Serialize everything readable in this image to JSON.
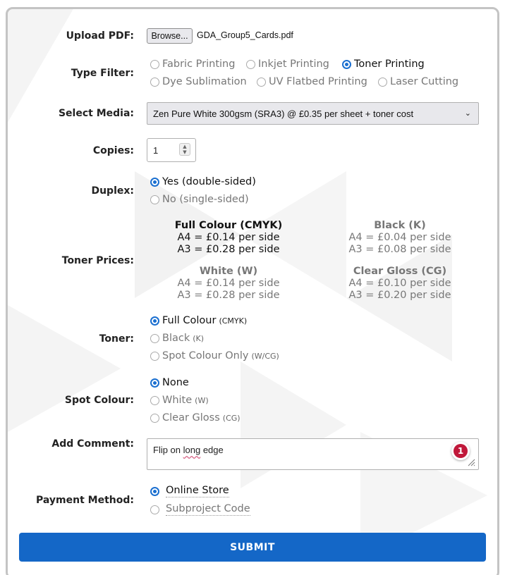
{
  "upload": {
    "label": "Upload PDF:",
    "button": "Browse...",
    "file_name": "GDA_Group5_Cards.pdf"
  },
  "type_filter": {
    "label": "Type Filter:",
    "options": [
      "Fabric Printing",
      "Inkjet Printing",
      "Toner Printing",
      "Dye Sublimation",
      "UV Flatbed Printing",
      "Laser Cutting"
    ],
    "selected": "Toner Printing"
  },
  "media": {
    "label": "Select Media:",
    "value": "Zen Pure White 300gsm (SRA3) @ £0.35 per sheet + toner cost"
  },
  "copies": {
    "label": "Copies:",
    "value": "1"
  },
  "duplex": {
    "label": "Duplex:",
    "options": [
      "Yes (double-sided)",
      "No (single-sided)"
    ],
    "selected": "Yes (double-sided)"
  },
  "toner_prices": {
    "label": "Toner Prices:",
    "groups": [
      {
        "title": "Full Colour (CMYK)",
        "a4": "A4 = £0.14 per side",
        "a3": "A3 = £0.28 per side"
      },
      {
        "title": "Black (K)",
        "a4": "A4 = £0.04 per side",
        "a3": "A3 = £0.08 per side"
      },
      {
        "title": "White (W)",
        "a4": "A4 = £0.14 per side",
        "a3": "A3 = £0.28 per side"
      },
      {
        "title": "Clear Gloss (CG)",
        "a4": "A4 = £0.10 per side",
        "a3": "A3 = £0.20 per side"
      }
    ]
  },
  "toner": {
    "label": "Toner:",
    "options": [
      {
        "text": "Full Colour",
        "code": "(CMYK)"
      },
      {
        "text": "Black",
        "code": "(K)"
      },
      {
        "text": "Spot Colour Only",
        "code": "(W/CG)"
      }
    ],
    "selected": "Full Colour"
  },
  "spot_colour": {
    "label": "Spot Colour:",
    "options": [
      {
        "text": "None",
        "code": ""
      },
      {
        "text": "White",
        "code": "(W)"
      },
      {
        "text": "Clear Gloss",
        "code": "(CG)"
      }
    ],
    "selected": "None"
  },
  "comment": {
    "label": "Add Comment:",
    "before": "Flip on ",
    "misspelled": "long",
    "after": " edge",
    "badge_count": "1"
  },
  "payment": {
    "label": "Payment Method:",
    "options": [
      "Online Store",
      "Subproject Code"
    ],
    "selected": "Online Store"
  },
  "submit": {
    "label": "SUBMIT"
  },
  "colors": {
    "accent": "#1467c7",
    "badge": "#c0183a"
  }
}
